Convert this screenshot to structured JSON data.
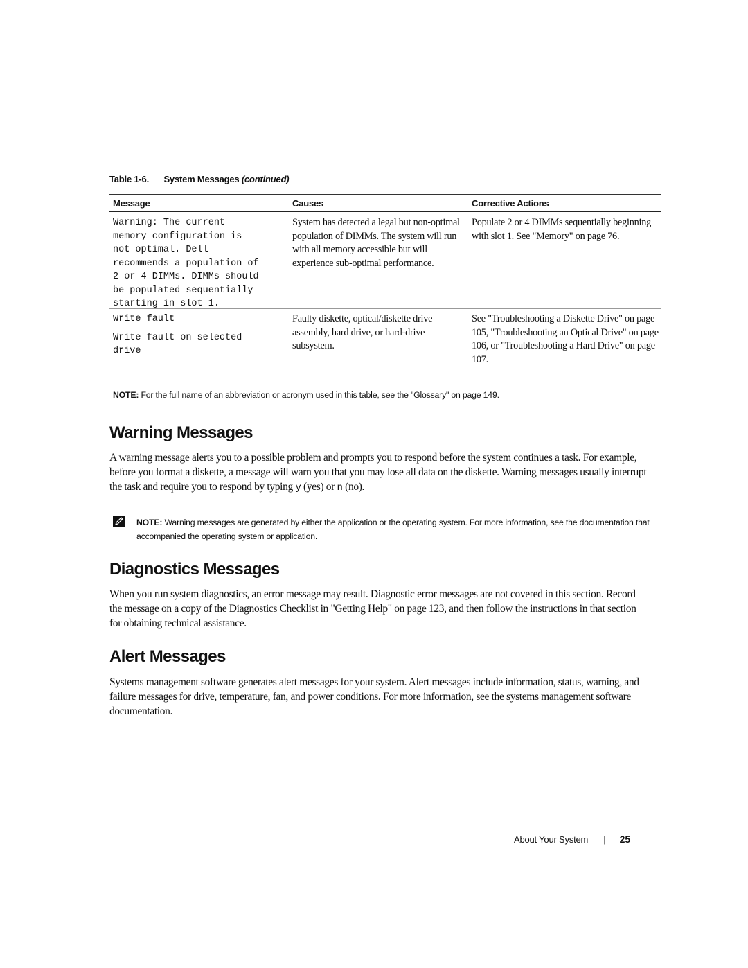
{
  "table": {
    "caption_number": "Table 1-6.",
    "caption_title": "System Messages",
    "caption_suffix": "(continued)",
    "headers": [
      "Message",
      "Causes",
      "Corrective Actions"
    ],
    "rows": [
      {
        "message_blocks": [
          [
            "Warning: The current",
            "memory configuration is",
            "not optimal. Dell",
            "recommends a population of",
            "2 or 4 DIMMs. DIMMs should",
            "be populated sequentially",
            "starting in slot 1."
          ]
        ],
        "causes": "System has detected a legal but non-optimal population of DIMMs. The system will run with all memory accessible but will experience sub-optimal performance.",
        "actions": "Populate 2 or 4 DIMMs sequentially beginning with slot 1. See \"Memory\" on page 76."
      },
      {
        "message_blocks": [
          [
            "Write fault"
          ],
          [
            "Write fault on selected",
            "drive"
          ]
        ],
        "causes": "Faulty diskette, optical/diskette drive assembly, hard drive, or hard-drive subsystem.",
        "actions": "See \"Troubleshooting a Diskette Drive\" on page 105, \"Troubleshooting an Optical Drive\" on page 106, or \"Troubleshooting a Hard Drive\" on page 107."
      }
    ],
    "note_label": "NOTE:",
    "note_text": " For the full name of an abbreviation or acronym used in this table, see the \"Glossary\" on page 149."
  },
  "sections": {
    "warning": {
      "title": "Warning Messages",
      "para_part1": "A warning message alerts you to a possible problem and prompts you to respond before the system continues a task. For example, before you format a diskette, a message will warn you that you may lose all data on the diskette. Warning messages usually interrupt the task and require you to respond by typing ",
      "key_yes": "y",
      "para_part2": " (yes) or ",
      "key_no": "n",
      "para_part3": " (no).",
      "note_icon": "pencil-note-icon",
      "note_label": "NOTE:",
      "note_text": " Warning messages are generated by either the application or the operating system. For more information, see the documentation that accompanied the operating system or application."
    },
    "diagnostics": {
      "title": "Diagnostics Messages",
      "para": "When you run system diagnostics, an error message may result. Diagnostic error messages are not covered in this section. Record the message on a copy of the Diagnostics Checklist in \"Getting Help\" on page 123, and then follow the instructions in that section for obtaining technical assistance."
    },
    "alert": {
      "title": "Alert Messages",
      "para": "Systems management software generates alert messages for your system. Alert messages include information, status, warning, and failure messages for drive, temperature, fan, and power conditions. For more information, see the systems management software documentation."
    }
  },
  "footer": {
    "section_name": "About Your System",
    "separator": "|",
    "page_number": "25"
  }
}
